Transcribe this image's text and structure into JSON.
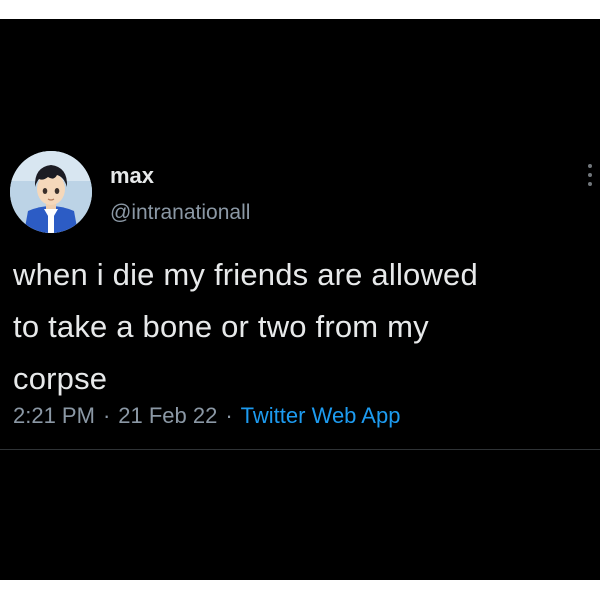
{
  "tweet": {
    "author": {
      "display_name": "max",
      "handle": "@intranationall",
      "avatar_icon": "anime-character-avatar"
    },
    "more_icon": "more-options-icon",
    "text_lines": [
      "when i die my friends are allowed",
      "to take a bone or two from my",
      "corpse"
    ],
    "time": "2:21 PM",
    "separator": "·",
    "date": "21 Feb 22",
    "source": "Twitter Web App"
  },
  "colors": {
    "background": "#000000",
    "text_primary": "#e7e9ea",
    "text_secondary": "#8b98a5",
    "link": "#1d9bf0",
    "divider": "#2f3336"
  }
}
